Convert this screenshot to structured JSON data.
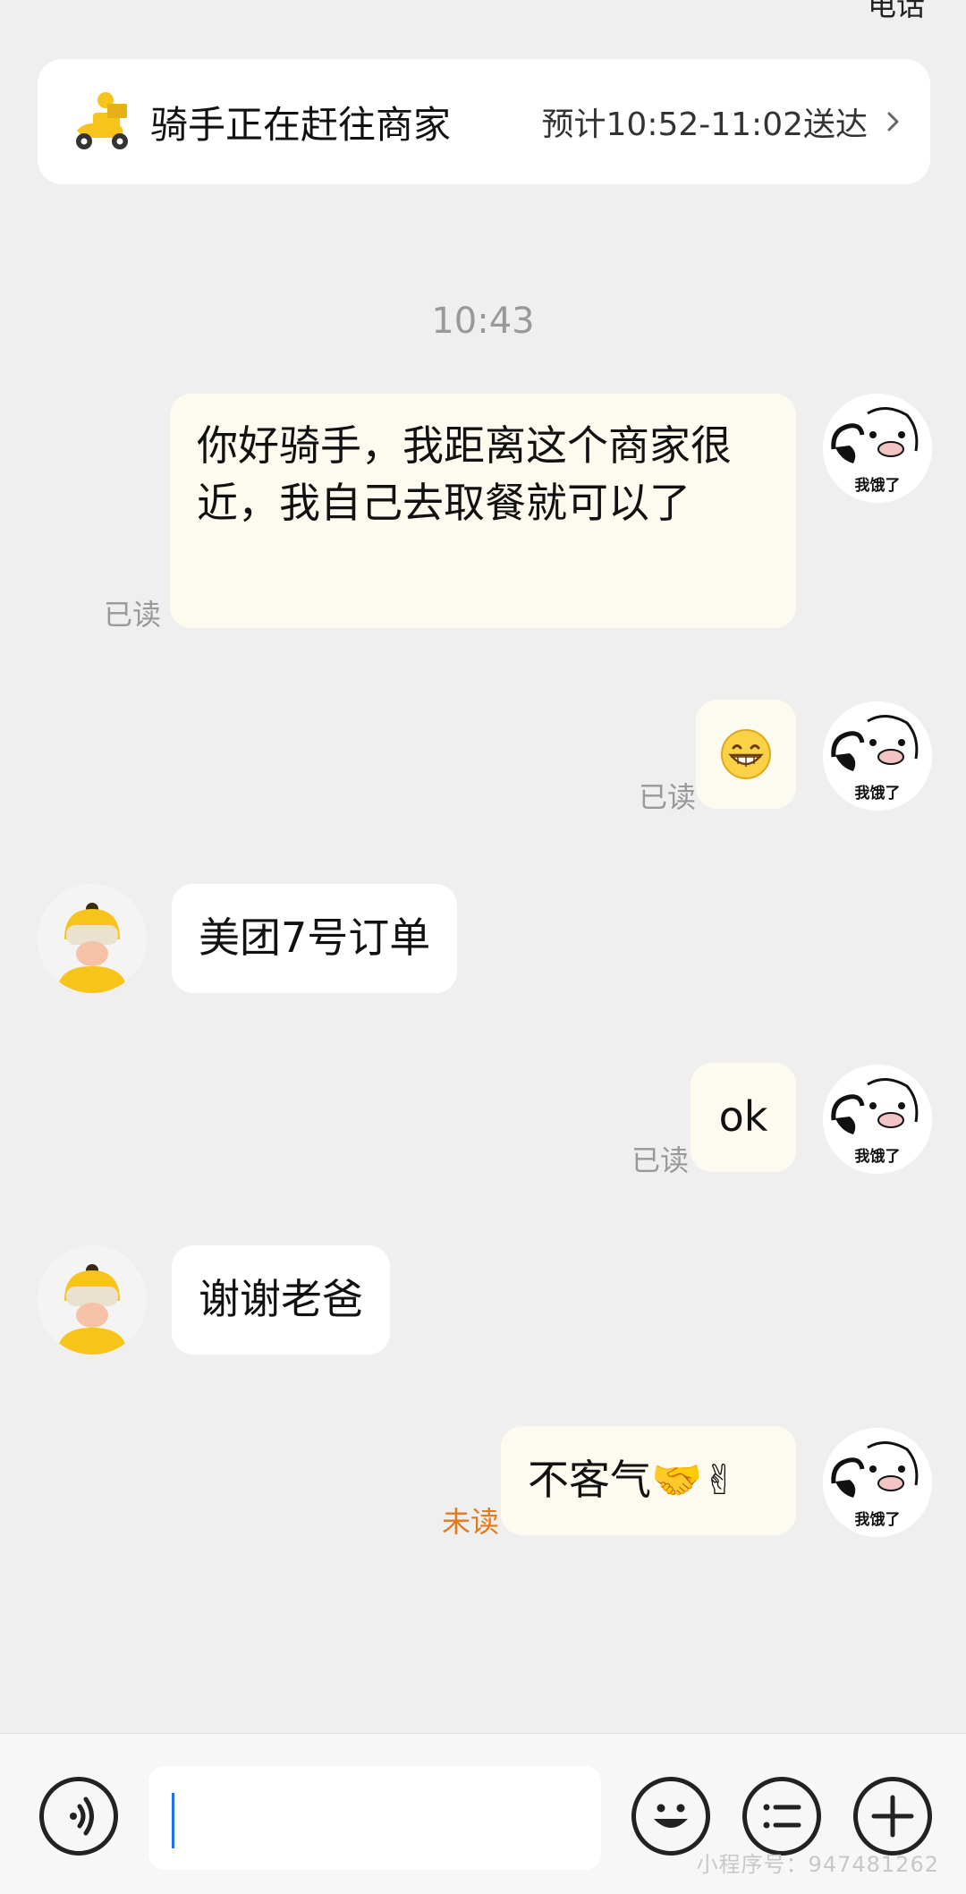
{
  "header": {
    "phone_label": "电话",
    "status_title": "骑手正在赶往商家",
    "eta": "预计10:52-11:02送达"
  },
  "chat": {
    "time_label": "10:43",
    "messages": [
      {
        "direction": "out",
        "text": "你好骑手，我距离这个商家很近，我自己去取餐就可以了",
        "read_status": "已读"
      },
      {
        "direction": "out",
        "text": "",
        "emoji": "grinning-face-icon",
        "read_status": "已读"
      },
      {
        "direction": "in",
        "text": "美团7号订单"
      },
      {
        "direction": "out",
        "text": "ok",
        "read_status": "已读"
      },
      {
        "direction": "in",
        "text": "谢谢老爸"
      },
      {
        "direction": "out",
        "text": "不客气🤝✌",
        "read_status": "未读"
      }
    ],
    "user_avatar_text": "我饿了"
  },
  "input_bar": {
    "placeholder": ""
  },
  "watermark": "小程序号：947481262",
  "colors": {
    "accent": "#f7c41b",
    "unread": "#e07b1f",
    "caret": "#1a73e8"
  }
}
